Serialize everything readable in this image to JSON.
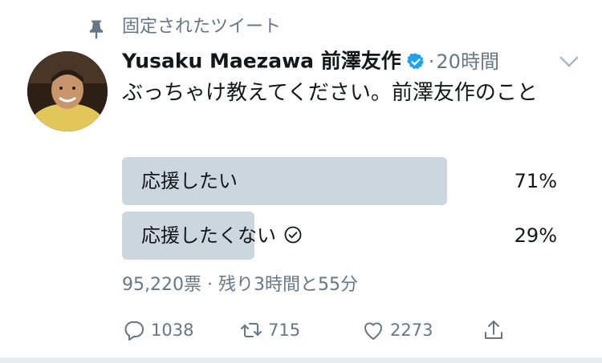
{
  "pinned": {
    "label": "固定されたツイート",
    "icon": "pin-icon"
  },
  "author": {
    "display_name": "Yusaku Maezawa 前澤友作",
    "verified": true,
    "time_sep": "·",
    "time": "20時間"
  },
  "tweet": {
    "text": "ぶっちゃけ教えてください。前澤友作のこと"
  },
  "poll": {
    "options": [
      {
        "label": "応援したい",
        "percent_label": "71%",
        "percent": 71,
        "selected": false
      },
      {
        "label": "応援したくない",
        "percent_label": "29%",
        "percent": 29,
        "selected": true
      }
    ],
    "meta": "95,220票 · 残り3時間と55分"
  },
  "actions": {
    "reply_count": "1038",
    "retweet_count": "715",
    "like_count": "2273"
  },
  "colors": {
    "poll_fill": "#ccd6dd",
    "verified_blue": "#1da1f2",
    "secondary_text": "#657786"
  }
}
